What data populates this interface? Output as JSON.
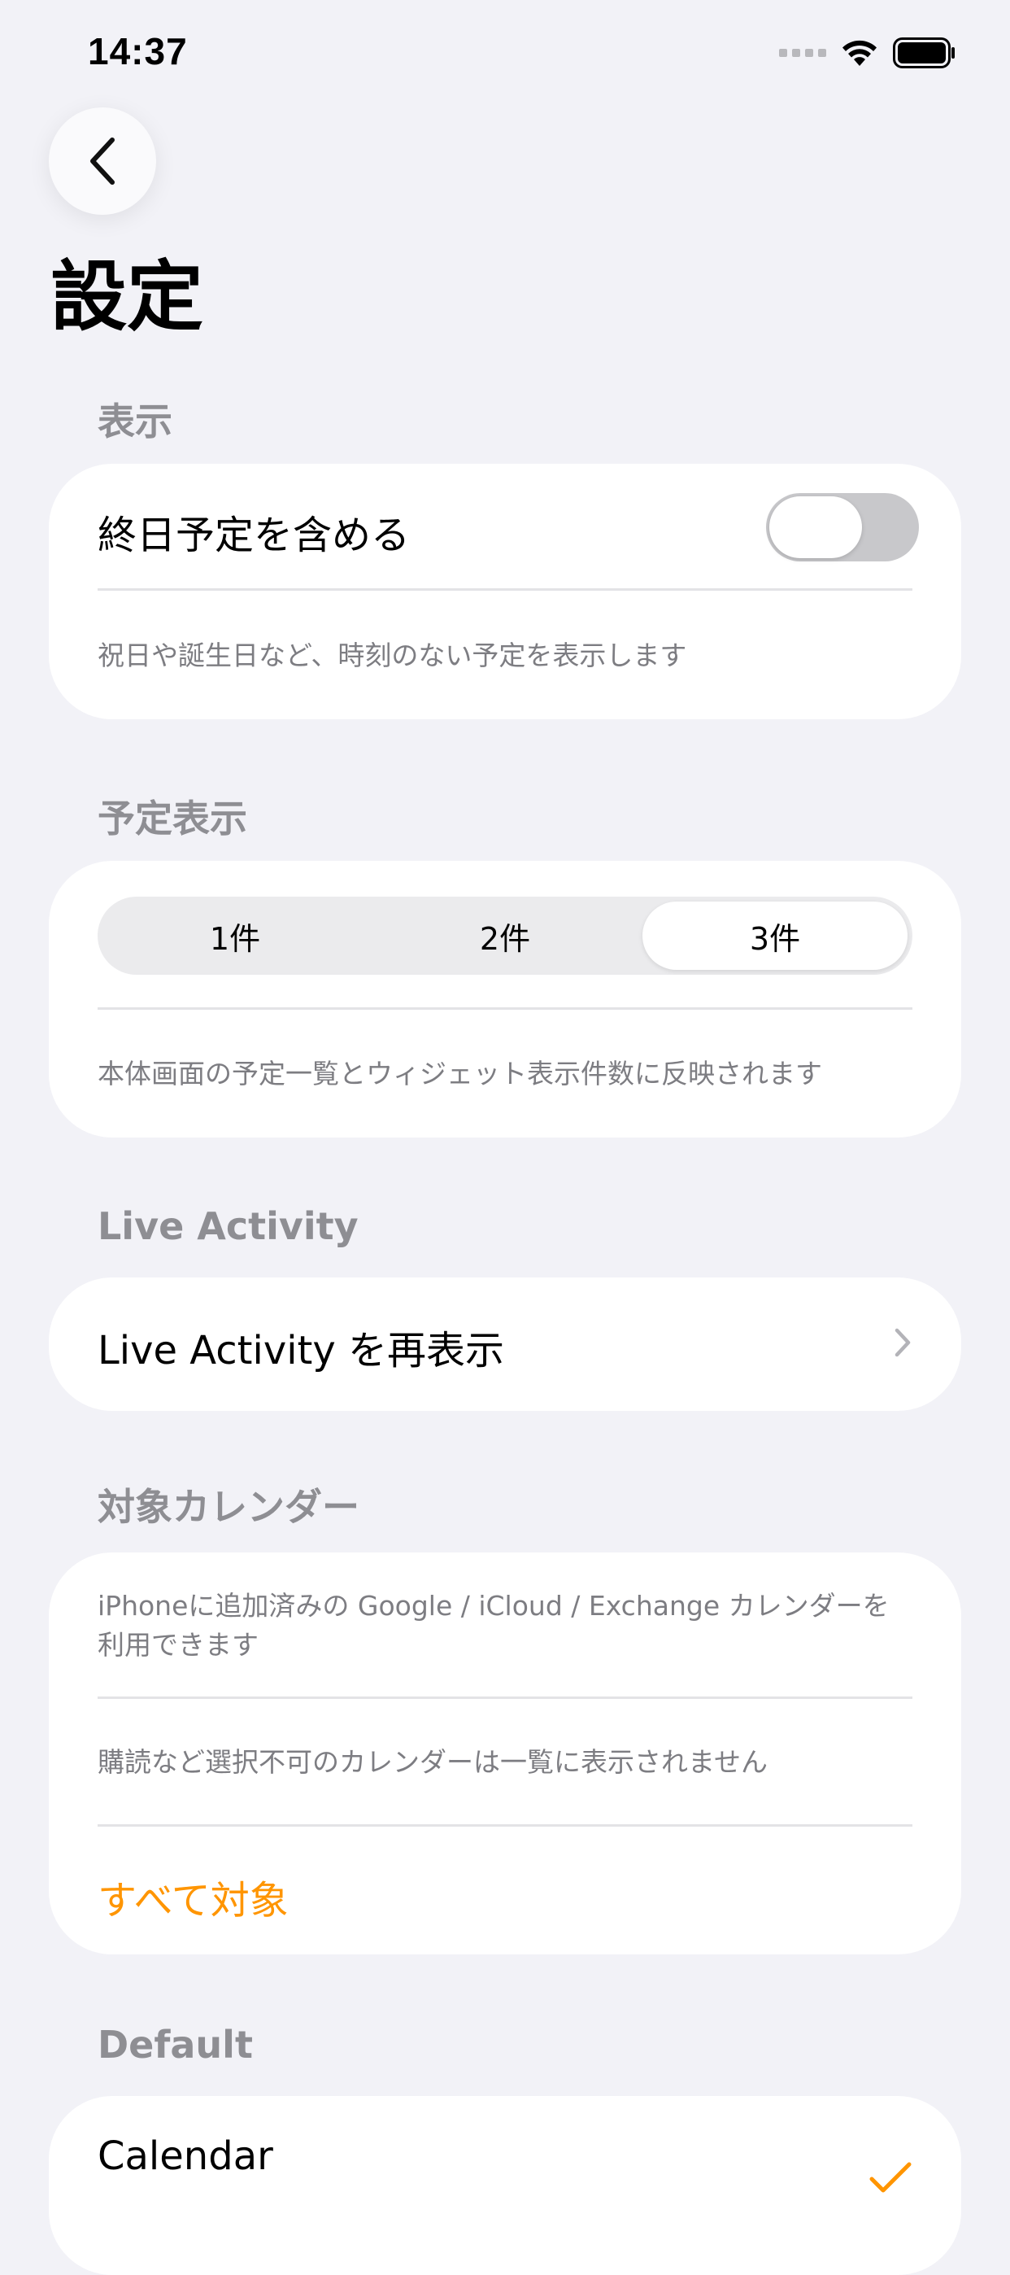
{
  "status_bar": {
    "time": "14:37",
    "signal_icon": "cellular-signal-dots",
    "wifi_icon": "wifi-icon",
    "battery_icon": "battery-full-icon"
  },
  "nav": {
    "back_icon": "chevron-left-icon",
    "title": "設定"
  },
  "sections": {
    "display": {
      "header": "表示",
      "all_day_label": "終日予定を含める",
      "all_day_enabled": false,
      "footnote": "祝日や誕生日など、時刻のない予定を表示します"
    },
    "event_count": {
      "header": "予定表示",
      "options": [
        "1件",
        "2件",
        "3件"
      ],
      "selected": "3件",
      "footnote": "本体画面の予定一覧とウィジェット表示件数に反映されます"
    },
    "live_activity": {
      "header": "Live Activity",
      "redisplay_label": "Live Activity を再表示"
    },
    "calendars": {
      "header": "対象カレンダー",
      "note1_line1": "iPhoneに追加済みの Google / iCloud / Exchange カレンダーを",
      "note1_line2": "利用できます",
      "note2": "購読など選択不可のカレンダーは一覧に表示されません",
      "select_all_label": "すべて対象"
    },
    "default": {
      "header": "Default",
      "calendar_name": "Calendar",
      "checked": true
    }
  },
  "colors": {
    "background": "#F2F2F7",
    "accent": "#FF9500",
    "secondary_text": "#8E8E93"
  }
}
